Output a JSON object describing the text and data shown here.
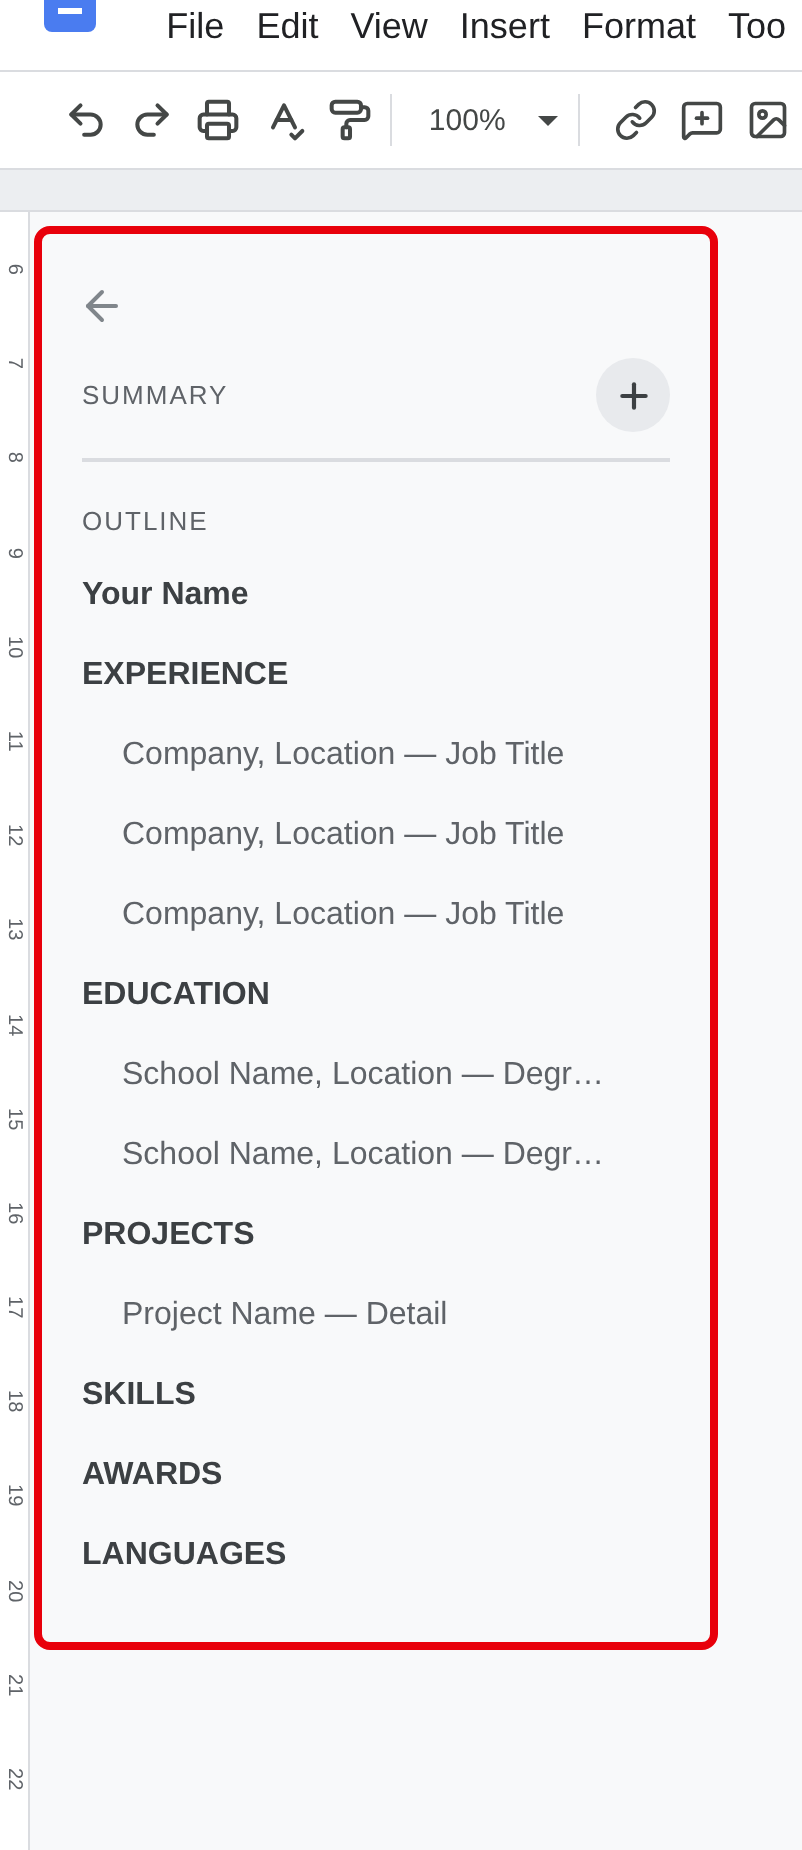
{
  "menu": [
    "File",
    "Edit",
    "View",
    "Insert",
    "Format",
    "Too"
  ],
  "toolbar": {
    "zoom": "100%"
  },
  "ruler": [
    "6",
    "7",
    "8",
    "9",
    "10",
    "11",
    "12",
    "13",
    "14",
    "15",
    "16",
    "17",
    "18",
    "19",
    "20",
    "21",
    "22"
  ],
  "panel": {
    "summary_label": "SUMMARY",
    "outline_label": "OUTLINE",
    "outline": [
      {
        "text": "Your Name"
      },
      {
        "text": "EXPERIENCE",
        "children": [
          {
            "text": "Company, Location — Job Title"
          },
          {
            "text": "Company, Location — Job Title"
          },
          {
            "text": "Company, Location — Job Title"
          }
        ]
      },
      {
        "text": "EDUCATION",
        "children": [
          {
            "text": "School Name, Location — Degr…"
          },
          {
            "text": "School Name, Location — Degr…"
          }
        ]
      },
      {
        "text": "PROJECTS",
        "children": [
          {
            "text": "Project Name — Detail"
          }
        ]
      },
      {
        "text": "SKILLS"
      },
      {
        "text": "AWARDS"
      },
      {
        "text": "LANGUAGES"
      }
    ]
  }
}
